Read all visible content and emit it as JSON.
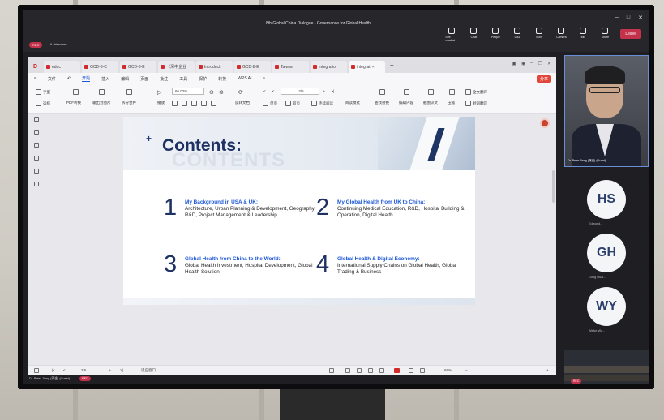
{
  "meeting": {
    "title": "8th Global China Dialogue - Governance for Global Health",
    "rec_label": "REC",
    "attendees": "6 attendees",
    "tools": [
      {
        "label": "See comfort"
      },
      {
        "label": "Chat"
      },
      {
        "label": "People"
      },
      {
        "label": "Q&A"
      },
      {
        "label": "More"
      },
      {
        "label": "Camera"
      },
      {
        "label": "Mic"
      },
      {
        "label": "Share"
      }
    ],
    "leave_label": "Leave",
    "presenter_label": "Dr. Peter Jiang (蒋逸) (Guest)"
  },
  "wps": {
    "tabs": [
      {
        "label": "educ"
      },
      {
        "label": "GCD-8-C"
      },
      {
        "label": "GCD-8-E"
      },
      {
        "label": "《深中企业"
      },
      {
        "label": "Introduct"
      },
      {
        "label": "GCD-8-E"
      },
      {
        "label": "Taiwan"
      },
      {
        "label": "Integratio"
      },
      {
        "label": "integrat"
      }
    ],
    "menu": [
      "文件",
      "开始",
      "插入",
      "编辑",
      "页面",
      "批注",
      "工具",
      "保护",
      "转换",
      "WPS AI"
    ],
    "menu_active": "开始",
    "share_label": "分享",
    "ribbon": {
      "hand": "手型",
      "select": "选择",
      "pdf": "PDF转换",
      "export": "输出为图片",
      "split": "拆分合并",
      "play": "播放",
      "zoom": "66.02%",
      "rotate": "旋转文档",
      "page": "2/5",
      "single": "单页",
      "double": "双页",
      "continuous": "连续阅读",
      "read_mode": "阅读模式",
      "find": "查找替换",
      "edit": "编辑内容",
      "ocr": "截图识文",
      "compress": "压缩",
      "translate_full": "全文翻译",
      "translate_word": "划词翻译"
    },
    "status": {
      "page": "2/5",
      "fit": "适应窗口",
      "zoom": "66%"
    }
  },
  "slide": {
    "title": "Contents:",
    "ghost": "CONTENTS",
    "items": [
      {
        "num": "1",
        "head": "My Background in USA & UK:",
        "body": "Architecture, Urban Planning & Development, Geography, R&D, Project Management & Leadership"
      },
      {
        "num": "2",
        "head": "My Global Health from UK to China:",
        "body": "Continuing Medical Education, R&D, Hospital Building & Operation, Digital Health"
      },
      {
        "num": "3",
        "head": "Global Health from China to the World:",
        "body": "Global Health Investment, Hospital Development, Global Health Solution"
      },
      {
        "num": "4",
        "head": "Global Health & Digital Economy:",
        "body": "International Supply Chains on Global Health, Global Trading & Business"
      }
    ]
  },
  "participants": {
    "video_name": "Dr. Peter Jiang (蒋逸) (Guest)",
    "avatars": [
      {
        "initials": "HS",
        "name": "Edmund..."
      },
      {
        "initials": "GH",
        "name": "Gong Huai..."
      },
      {
        "initials": "WY",
        "name": "Weike Wu..."
      }
    ],
    "room_rec": "REC"
  }
}
